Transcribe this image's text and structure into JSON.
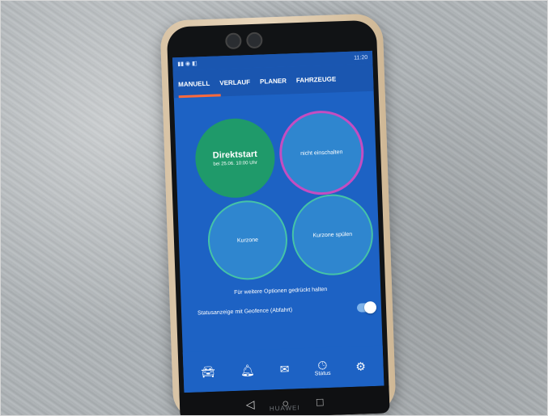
{
  "tabs": [
    "MANUELL",
    "VERLAUF",
    "PLANER",
    "FAHRZEUGE"
  ],
  "status_bar": {
    "time": "11:20"
  },
  "tiles": {
    "tile1": {
      "title": "Direktstart",
      "subtitle": "bei 25.06. 10:00 Uhr"
    },
    "tile2": {
      "label": "nicht einschalten"
    },
    "tile3": {
      "label": "Kurzone"
    },
    "tile4": {
      "label": "Kurzone spülen"
    }
  },
  "hint_text": "Für weitere Optionen gedrückt halten",
  "toggle_text": "Statusanzeige mit Geofence (Abfahrt)",
  "bottom_nav": {
    "status_label": "Status"
  },
  "device_brand": "HUAWEI",
  "colors": {
    "app_blue": "#1d62c4",
    "tab_underline": "#ff6a3c",
    "tile_green": "#1f9a6a",
    "tile_outline_pink": "#c44dc1",
    "tile_outline_teal": "#45c3a7"
  },
  "icons": {
    "bottom_nav": [
      "car-icon",
      "bell-icon",
      "message-icon",
      "clock-icon",
      "gear-icon"
    ],
    "android_nav": [
      "back-icon",
      "home-icon",
      "recents-icon"
    ]
  }
}
